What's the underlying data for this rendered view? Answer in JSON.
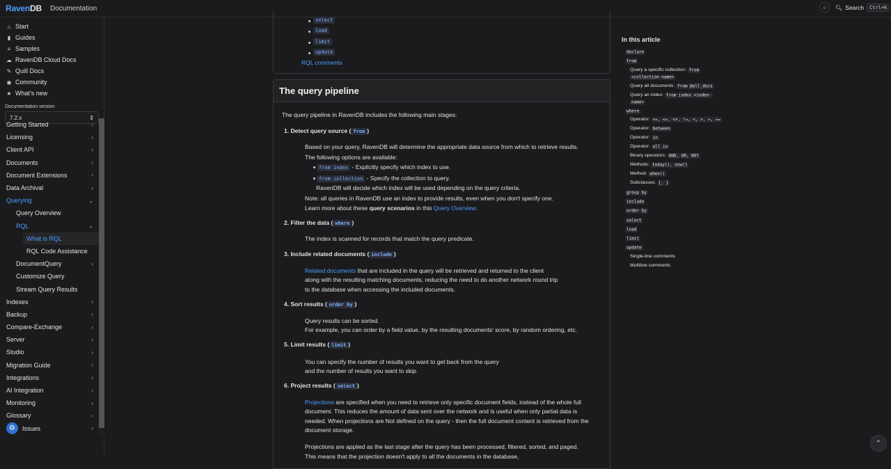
{
  "header": {
    "logo_a": "Raven",
    "logo_b": "DB",
    "section": "Documentation",
    "theme_icon": "sun-icon",
    "search_label": "Search",
    "search_shortcut": "Ctrl+K"
  },
  "sidebar": {
    "top_links": [
      {
        "label": "Start",
        "icon": "home-icon"
      },
      {
        "label": "Guides",
        "icon": "book-icon"
      },
      {
        "label": "Samples",
        "icon": "stack-icon"
      },
      {
        "label": "RavenDB Cloud Docs",
        "icon": "cloud-icon"
      },
      {
        "label": "Quill Docs",
        "icon": "quill-icon"
      },
      {
        "label": "Community",
        "icon": "chat-icon"
      },
      {
        "label": "What's new",
        "icon": "star-icon"
      }
    ],
    "version_label": "Documentation version",
    "version_value": "7.2.x",
    "tree": [
      {
        "label": "Getting Started"
      },
      {
        "label": "Licensing"
      },
      {
        "label": "Client API"
      },
      {
        "label": "Documents"
      },
      {
        "label": "Document Extensions"
      },
      {
        "label": "Data Archival"
      },
      {
        "label": "Querying"
      },
      {
        "label": "Query Overview"
      },
      {
        "label": "RQL"
      },
      {
        "label": "What is RQL"
      },
      {
        "label": "RQL Code Assistance"
      },
      {
        "label": "DocumentQuery"
      },
      {
        "label": "Customize Query"
      },
      {
        "label": "Stream Query Results"
      },
      {
        "label": "Indexes"
      },
      {
        "label": "Backup"
      },
      {
        "label": "Compare-Exchange"
      },
      {
        "label": "Server"
      },
      {
        "label": "Studio"
      },
      {
        "label": "Migration Guide"
      },
      {
        "label": "Integrations"
      },
      {
        "label": "AI Integration"
      },
      {
        "label": "Monitoring"
      },
      {
        "label": "Glossary"
      },
      {
        "label": "Issues"
      }
    ]
  },
  "toc_box": {
    "items": [
      "select",
      "load",
      "limit",
      "update"
    ],
    "rql_comments": "RQL comments"
  },
  "article": {
    "heading": "The query pipeline",
    "intro": "The query pipeline in RavenDB includes the following main stages:",
    "s1_title": "1. Detect query source (",
    "s1_code": "from",
    "s1_p1": "Based on your query, RavenDB will determine the appropriate data source from which to retrieve results.",
    "s1_p2": "The following options are available:",
    "s1_opt1_code": "from index",
    "s1_opt1_text": " - Explicitly specify which index to use.",
    "s1_opt2_code": "from collection",
    "s1_opt2_text": " - Specify the collection to query.",
    "s1_opt2_text2": "RavenDB will decide which index will be used depending on the query criteria.",
    "s1_note": "Note: all queries in RavenDB use an index to provide results, even when you don't specify one.",
    "s1_learn_a": "Learn more about these ",
    "s1_learn_b": "query scenarios",
    "s1_learn_c": " in this ",
    "s1_learn_link": "Query Overview",
    "s2_title": "2. Filter the data (",
    "s2_code": "where",
    "s2_p": "The index is scanned for records that match the query predicate.",
    "s3_title": "3. Include related documents (",
    "s3_code": "include",
    "s3_link": "Related documents",
    "s3_p1": " that are included in the query will be retrieved and returned to the client",
    "s3_p2": "along with the resulting matching documents, reducing the need to do another network round trip",
    "s3_p3": "to the database when accessing the included documents.",
    "s4_title": "4. Sort results (",
    "s4_code": "order by",
    "s4_p1": "Query results can be sorted.",
    "s4_p2": "For example, you can order by a field value, by the resulting documents' score, by random ordering, etc.",
    "s5_title": "5. Limit results (",
    "s5_code": "limit",
    "s5_p1": "You can specify the number of results you want to get back from the query",
    "s5_p2": "and the number of results you want to skip.",
    "s6_title": "6. Project results (",
    "s6_code": "select",
    "s6_link": "Projections",
    "s6_p1": " are specified when you need to retrieve only specific document fields, instead of the whole full",
    "s6_p2": "document. This reduces the amount of data sent over the network and is useful when only partial data is",
    "s6_p3": "needed. When projections are Not defined on the query - then the full document content is retrieved from the",
    "s6_p4": "document storage.",
    "s6_p5": "Projections are applied as the last stage after the query has been processed, filtered, sorted, and paged.",
    "s6_p6": "This means that the projection doesn't apply to all the documents in the database,"
  },
  "right_toc": {
    "title": "In this article",
    "declare": "declare",
    "from": "from",
    "r1": "Query a specific collection:",
    "r1_code_a": "from",
    "r1_code_b": "<collection-name>",
    "r2": "Query all documents:",
    "r2_code": "from @all_docs",
    "r3": "Query an index:",
    "r3_code_a": "from index <index-",
    "r3_code_b": "name>",
    "where": "where",
    "op1": "Operator:",
    "op1_code": ">=, <=, <>, !=, <, >, =, ==",
    "op2": "Operator:",
    "op2_code": "between",
    "op3": "Operator:",
    "op3_code": "in",
    "op4": "Operator:",
    "op4_code": "all in",
    "bin": "Binary operators:",
    "bin_code": "AND, OR, NOT",
    "methods": "Methods:",
    "methods_code": "today(), now()",
    "method": "Method:",
    "method_code": "when()",
    "subclauses": "Subclauses:",
    "subclauses_code": "{, }",
    "group_by": "group by",
    "include": "include",
    "order_by": "order by",
    "select": "select",
    "load": "load",
    "limit": "limit",
    "update": "update",
    "single": "Single-line comments",
    "multi": "Multiline comments"
  }
}
